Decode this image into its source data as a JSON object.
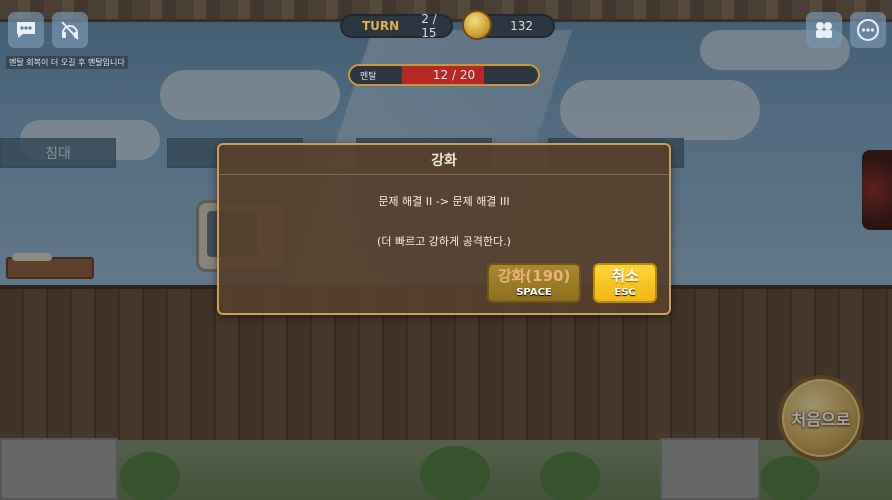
{
  "hud": {
    "turn_label": "TURN",
    "turn_value": "2 / 15",
    "gold_value": "132",
    "stress_label": "멘탈",
    "stress_value": "12 / 20",
    "stress_fraction": 0.6,
    "notice": "멘탈 회복이 더 오길 후 멘탈입니다"
  },
  "scene": {
    "room_buttons": [
      "침대",
      "",
      "",
      "",
      ""
    ],
    "home_button": "처음으로"
  },
  "dialog": {
    "title": "강화",
    "upgrade_line": "문제 해결 II -> 문제 해결 III",
    "description": "(더 빠르고 강하게 공격한다.)",
    "upgrade_button": "강화(190)",
    "upgrade_key": "SPACE",
    "cancel_button": "취소",
    "cancel_key": "ESC"
  },
  "colors": {
    "dialog_bg": "#56402c",
    "dialog_border": "#c8a05a",
    "cancel_button": "#ffd43a",
    "stress_fill": "#b42a22",
    "turn_label": "#e2b04a"
  },
  "icons": [
    "chat-icon",
    "sound-off-icon",
    "people-icon",
    "more-icon",
    "gold-coin-icon"
  ]
}
